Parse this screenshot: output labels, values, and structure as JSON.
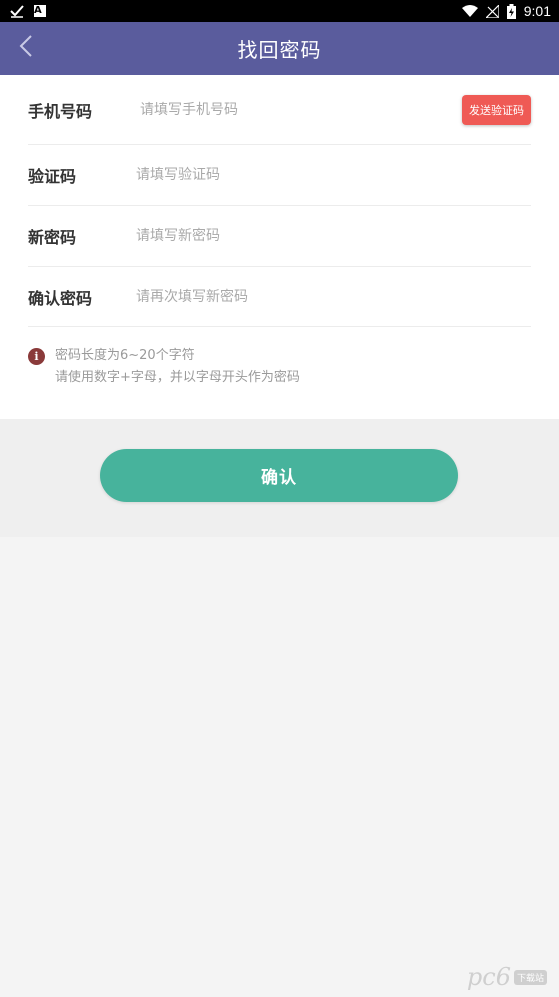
{
  "status_bar": {
    "time": "9:01",
    "left_icons": [
      "check-download-icon",
      "a-notification-icon"
    ],
    "right_icons": [
      "wifi-icon",
      "no-signal-icon",
      "battery-charging-icon"
    ]
  },
  "nav": {
    "title": "找回密码",
    "background": "#5a5c9d"
  },
  "form": {
    "phone": {
      "label": "手机号码",
      "placeholder": "请填写手机号码",
      "value": ""
    },
    "send_code_label": "发送验证码",
    "code": {
      "label": "验证码",
      "placeholder": "请填写验证码",
      "value": ""
    },
    "new_password": {
      "label": "新密码",
      "placeholder": "请填写新密码",
      "value": ""
    },
    "confirm_password": {
      "label": "确认密码",
      "placeholder": "请再次填写新密码",
      "value": ""
    }
  },
  "hint": {
    "line1": "密码长度为6~20个字符",
    "line2": "请使用数字+字母，并以字母开头作为密码"
  },
  "confirm_label": "确认",
  "colors": {
    "accent": "#47b39c",
    "send_code": "#ef5a55",
    "info_icon": "#8a3a3a"
  },
  "watermark": {
    "text": "pc6",
    "tag": "下载站"
  }
}
